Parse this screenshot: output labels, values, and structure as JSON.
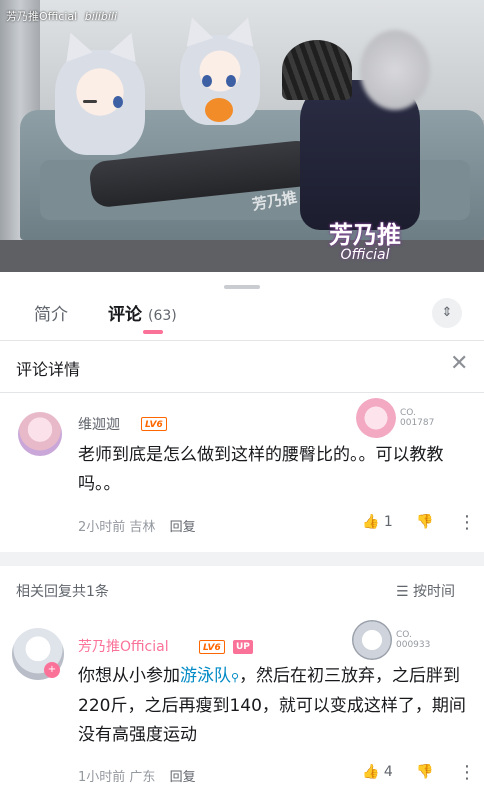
{
  "video": {
    "watermark_top": "芳乃推Official",
    "watermark_brand": "bilibili",
    "watermark_big": "芳乃推",
    "watermark_big_sub": "Official",
    "watermark_mid": "芳乃推"
  },
  "tabs": [
    {
      "label": "简介"
    },
    {
      "label": "评论",
      "count": "(63)"
    }
  ],
  "detail": {
    "title": "评论详情"
  },
  "main_comment": {
    "username": "维迦迦",
    "level": "LV6",
    "deco_label_1": "CO.",
    "deco_label_2": "001787",
    "text": "老师到底是怎么做到这样的腰臀比的。。可以教教吗。。",
    "time": "2小时前",
    "location": "吉林",
    "reply_label": "回复",
    "likes": "1"
  },
  "replies_header": {
    "label": "相关回复共1条",
    "sort_label": "按时间"
  },
  "reply": {
    "username": "芳乃推Official",
    "level": "LV6",
    "up_badge": "UP",
    "deco_label_1": "CO.",
    "deco_label_2": "000933",
    "text_before": "你想从小参加",
    "text_link": "游泳队",
    "text_after": "，然后在初三放弃，之后胖到220斤，之后再瘦到140，就可以变成这样了，期间没有高强度运动",
    "time": "1小时前",
    "location": "广东",
    "reply_label": "回复",
    "likes": "4"
  },
  "colors": {
    "accent": "#fb7299",
    "link": "#008ac5",
    "level": "#ff6600"
  }
}
